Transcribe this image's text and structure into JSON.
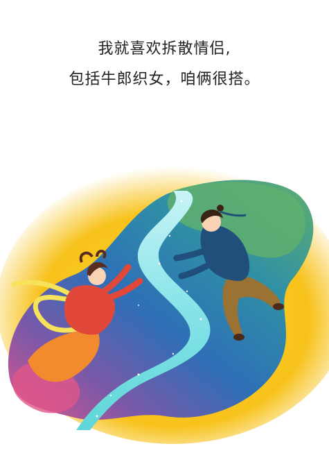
{
  "caption": {
    "line1": "我就喜欢拆散情侣,",
    "line2": "包括牛郎织女，咱俩很搭。"
  },
  "colors": {
    "glow": "#F7C21A",
    "land_green": "#5FAF6E",
    "land_teal": "#2F8FA6",
    "land_blue": "#2E6FB7",
    "land_purple": "#7B58A8",
    "land_pink": "#E0568A",
    "river": "#7FE5E6",
    "weaver_robe": "#E2483A",
    "weaver_skirt": "#F28A2E",
    "ribbon": "#F6E35A",
    "cowherd_robe": "#1F4F7A",
    "cowherd_pants": "#9A7334"
  },
  "figures": {
    "weaver_girl": "weaver-girl-figure",
    "cowherd": "cowherd-figure"
  }
}
